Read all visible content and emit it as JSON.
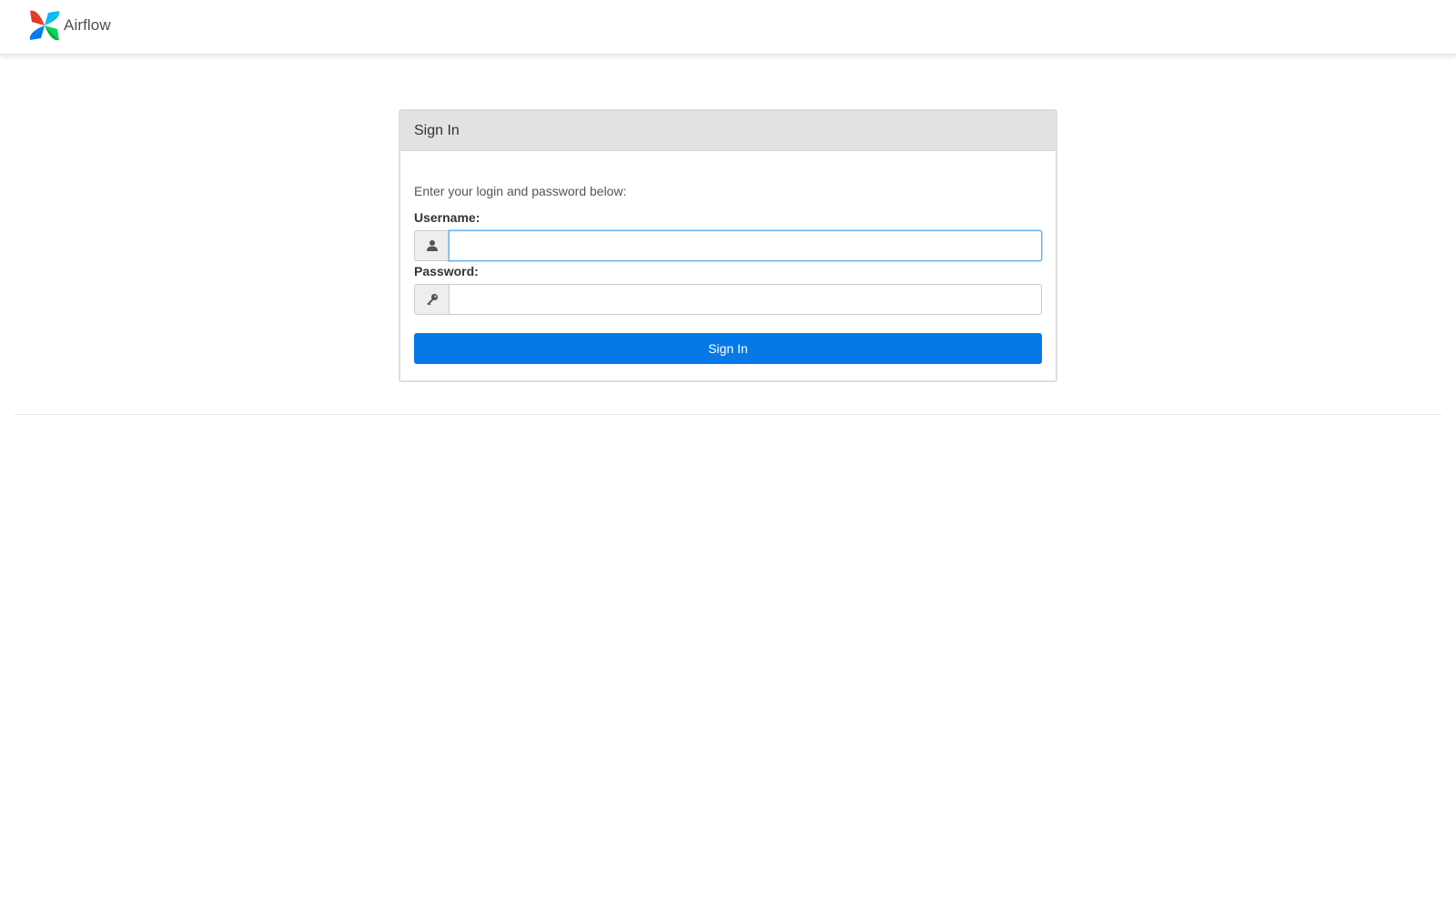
{
  "app": {
    "name": "Airflow"
  },
  "login": {
    "heading": "Sign In",
    "instructions": "Enter your login and password below:",
    "username": {
      "label": "Username:",
      "value": "",
      "icon": "user-icon"
    },
    "password": {
      "label": "Password:",
      "value": "",
      "icon": "key-icon"
    },
    "submit_label": "Sign In"
  },
  "colors": {
    "primary": "#0679e8",
    "panel_heading": "#e2e2e2",
    "focus": "#66afe9",
    "logo_red": "#e43921",
    "logo_blue": "#0cb6ff",
    "logo_green": "#00ad46",
    "logo_navy": "#017cee"
  }
}
